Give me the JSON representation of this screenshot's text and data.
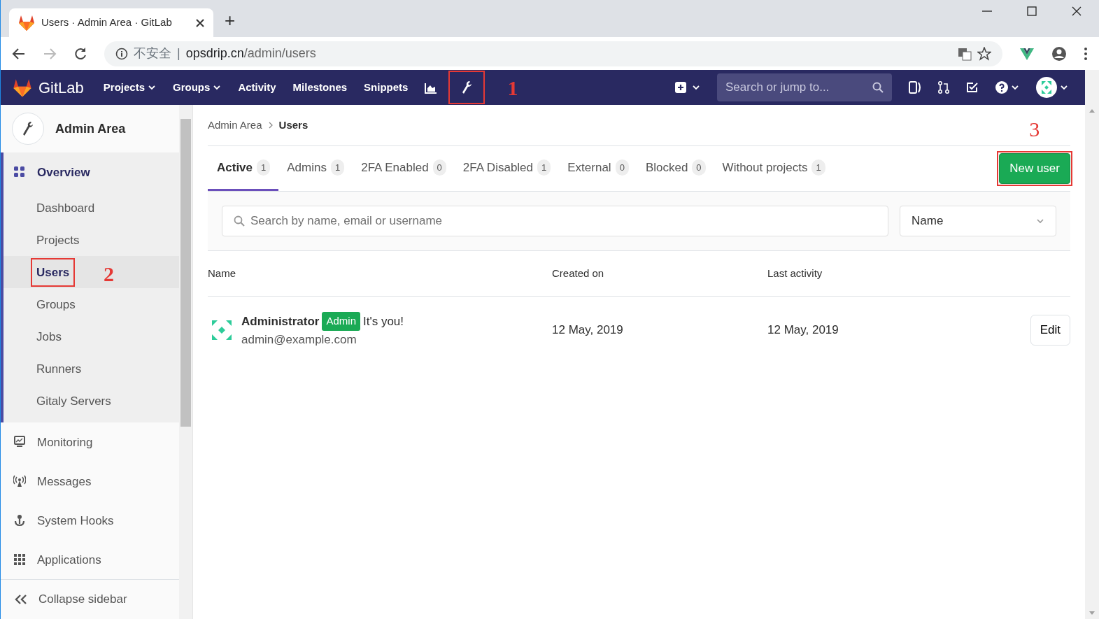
{
  "browser": {
    "tab_title": "Users · Admin Area · GitLab",
    "new_tab": "+",
    "security": "不安全",
    "separator": "|",
    "url_host": "opsdrip.cn",
    "url_path": "/admin/users"
  },
  "navbar": {
    "brand": "GitLab",
    "links": [
      {
        "label": "Projects",
        "dropdown": true
      },
      {
        "label": "Groups",
        "dropdown": true
      },
      {
        "label": "Activity",
        "dropdown": false
      },
      {
        "label": "Milestones",
        "dropdown": false
      },
      {
        "label": "Snippets",
        "dropdown": false
      }
    ],
    "search_placeholder": "Search or jump to..."
  },
  "sidebar": {
    "title": "Admin Area",
    "sections": [
      {
        "label": "Overview",
        "selected": true,
        "children": [
          {
            "label": "Dashboard",
            "selected": false
          },
          {
            "label": "Projects",
            "selected": false
          },
          {
            "label": "Users",
            "selected": true
          },
          {
            "label": "Groups",
            "selected": false
          },
          {
            "label": "Jobs",
            "selected": false
          },
          {
            "label": "Runners",
            "selected": false
          },
          {
            "label": "Gitaly Servers",
            "selected": false
          }
        ]
      },
      {
        "label": "Monitoring",
        "selected": false
      },
      {
        "label": "Messages",
        "selected": false
      },
      {
        "label": "System Hooks",
        "selected": false
      },
      {
        "label": "Applications",
        "selected": false
      }
    ],
    "collapse": "Collapse sidebar"
  },
  "breadcrumb": [
    "Admin Area",
    "Users"
  ],
  "tabs": [
    {
      "label": "Active",
      "count": "1",
      "selected": true
    },
    {
      "label": "Admins",
      "count": "1",
      "selected": false
    },
    {
      "label": "2FA Enabled",
      "count": "0",
      "selected": false
    },
    {
      "label": "2FA Disabled",
      "count": "1",
      "selected": false
    },
    {
      "label": "External",
      "count": "0",
      "selected": false
    },
    {
      "label": "Blocked",
      "count": "0",
      "selected": false
    },
    {
      "label": "Without projects",
      "count": "1",
      "selected": false
    }
  ],
  "new_user_button": "New user",
  "search": {
    "placeholder": "Search by name, email or username"
  },
  "sort": {
    "value": "Name"
  },
  "table": {
    "columns": [
      "Name",
      "Created on",
      "Last activity"
    ],
    "rows": [
      {
        "name": "Administrator",
        "badge": "Admin",
        "note": "It's you!",
        "email": "admin@example.com",
        "created": "12 May, 2019",
        "last_activity": "12 May, 2019",
        "action": "Edit"
      }
    ]
  },
  "annotations": [
    "1",
    "2",
    "3"
  ]
}
